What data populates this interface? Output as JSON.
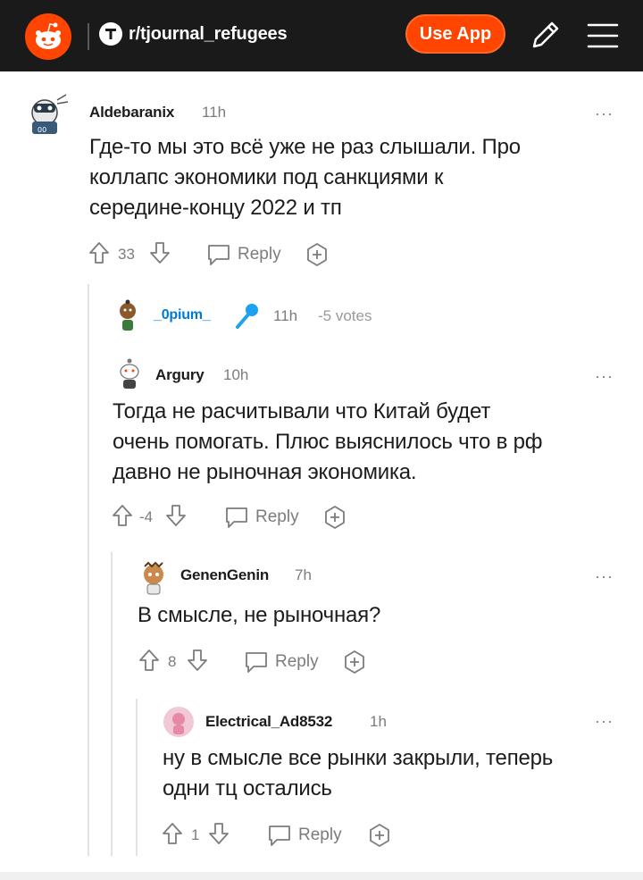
{
  "header": {
    "subreddit": "r/tjournal_refugees",
    "use_app_label": "Use App"
  },
  "colors": {
    "brand": "#ff4500",
    "header_bg": "#1a1a1b",
    "mic": "#1da1f2",
    "flair_link": "#0079d3"
  },
  "comments": [
    {
      "author": "Aldebaranix",
      "time": "11h",
      "body": [
        "Где-то мы это всё уже не раз слышали. Про",
        "коллапс экономики под санкциями к",
        "середине-концу 2022 и тп"
      ],
      "score": "33",
      "reply_label": "Reply"
    },
    {
      "author": "_0pium_",
      "time": "11h",
      "votes": "-5 votes",
      "icon": "microphone-icon"
    },
    {
      "author": "Argury",
      "time": "10h",
      "body": [
        "Тогда не расчитывали что Китай будет",
        "очень помогать. Плюс выяснилось что в рф",
        "давно не рыночная экономика."
      ],
      "score": "-4",
      "reply_label": "Reply"
    },
    {
      "author": "GenenGenin",
      "time": "7h",
      "body": [
        "В смысле, не рыночная?"
      ],
      "score": "8",
      "reply_label": "Reply"
    },
    {
      "author": "Electrical_Ad8532",
      "time": "1h",
      "body": [
        "ну в смысле все рынки закрыли, теперь",
        "одни тц остались"
      ],
      "score": "1",
      "reply_label": "Reply"
    }
  ],
  "more_label": "···"
}
